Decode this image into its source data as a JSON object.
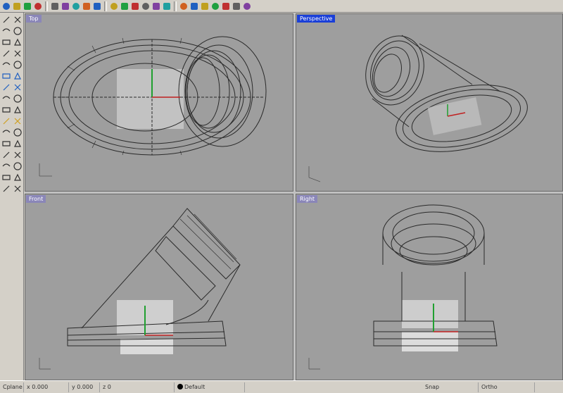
{
  "toolbar": {
    "icons": [
      "new-file-icon",
      "open-file-icon",
      "save-icon",
      "print-icon",
      "cut-icon",
      "copy-icon",
      "paste-icon",
      "undo-icon",
      "redo-icon",
      "pan-icon",
      "rotate-view-icon",
      "zoom-icon",
      "zoom-window-icon",
      "zoom-extents-icon",
      "select-icon",
      "color-icon",
      "render-icon",
      "shade-icon",
      "material-icon",
      "sphere-icon",
      "grid-icon",
      "help-icon"
    ]
  },
  "left_toolbar": {
    "icons": [
      "point-icon",
      "line-icon",
      "polyline-icon",
      "curve-icon",
      "circle-icon",
      "arc-icon",
      "ellipse-icon",
      "rectangle-icon",
      "polygon-icon",
      "text-icon",
      "surface-icon",
      "extrude-icon",
      "loft-icon",
      "sweep-icon",
      "revolve-icon",
      "box-icon",
      "sphere-icon",
      "cylinder-icon",
      "boolean-icon",
      "fillet-icon",
      "trim-icon",
      "split-icon",
      "join-icon",
      "explode-icon",
      "move-icon",
      "copy-icon",
      "rotate-icon",
      "scale-icon",
      "mirror-icon",
      "array-icon",
      "dimension-icon",
      "layer-icon"
    ]
  },
  "viewports": {
    "top": {
      "label": "Top"
    },
    "perspective": {
      "label": "Perspective"
    },
    "front": {
      "label": "Front"
    },
    "right": {
      "label": "Right"
    }
  },
  "statusbar": {
    "cplane": "Cplane",
    "x": "x 0.000",
    "y": "y 0.000",
    "z": "z 0",
    "layer": "Default",
    "snap": "Snap",
    "ortho": "Ortho"
  },
  "colors": {
    "viewport_bg": "#9e9e9e",
    "wire": "#2a2a2a",
    "active_label": "#1a3fd8",
    "x_axis": "#c02020",
    "y_axis": "#20a030"
  }
}
